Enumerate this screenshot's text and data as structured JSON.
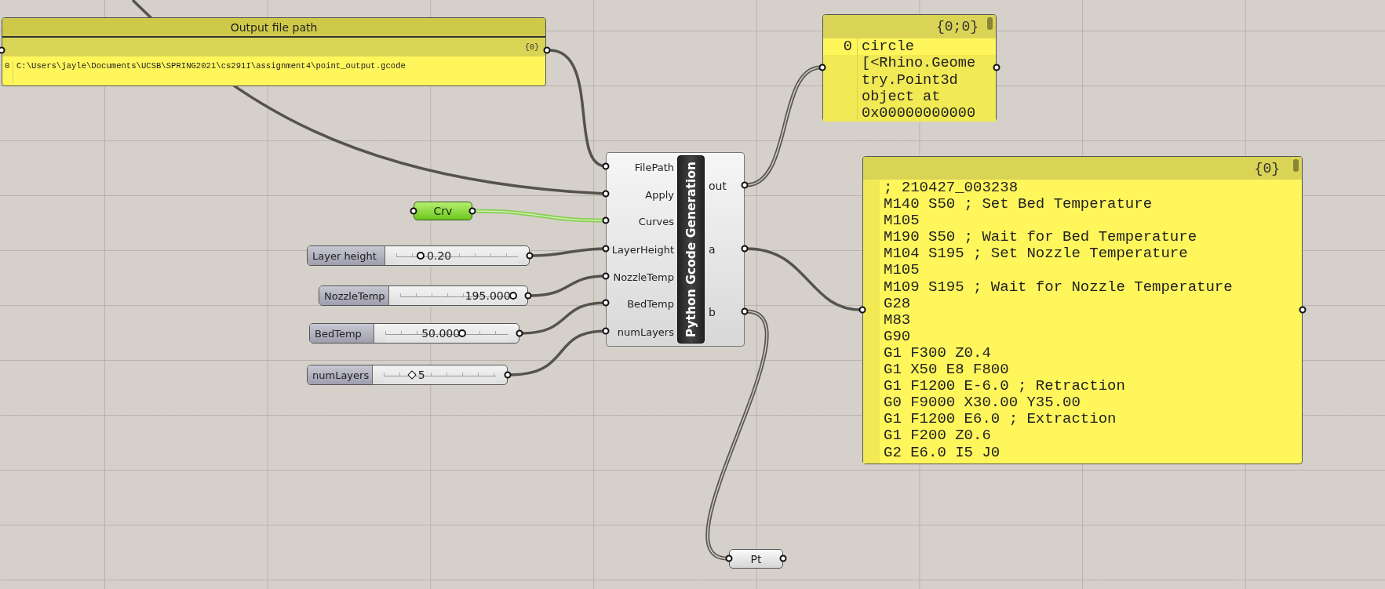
{
  "file_path_panel": {
    "title": "Output file path",
    "path": "{0}",
    "index": "0",
    "value": "C:\\Users\\jayle\\Documents\\UCSB\\SPRING2021\\cs291I\\assignment4\\point_output.gcode"
  },
  "point_panel": {
    "path": "{0;0}",
    "rows": [
      {
        "index": "0",
        "text": "circle",
        "highlighted": true
      },
      {
        "text": "[<Rhino.Geome",
        "highlighted": false
      },
      {
        "text": "try.Point3d",
        "highlighted": false
      },
      {
        "text": "object at",
        "highlighted": false
      },
      {
        "text": "0x00000000000",
        "highlighted": false
      }
    ]
  },
  "curve_param": {
    "label": "Crv"
  },
  "sliders": [
    {
      "label": "Layer height",
      "value": "0.20",
      "level": 0.2,
      "kind": "float"
    },
    {
      "label": "NozzleTemp",
      "value": "195.000",
      "level": 0.97,
      "kind": "float"
    },
    {
      "label": "BedTemp",
      "value": "50.000",
      "level": 0.63,
      "kind": "float"
    },
    {
      "label": "numLayers",
      "value": "5",
      "level": 0.25,
      "kind": "integer"
    }
  ],
  "component": {
    "name": "Python Gcode Generation",
    "inputs": [
      "FilePath",
      "Apply",
      "Curves",
      "LayerHeight",
      "NozzleTemp",
      "BedTemp",
      "numLayers"
    ],
    "outputs": [
      "out",
      "a",
      "b"
    ]
  },
  "gcode_panel": {
    "path": "{0}",
    "lines": [
      "; 210427_003238",
      "M140 S50 ; Set Bed Temperature",
      "M105",
      "M190 S50 ; Wait for Bed Temperature",
      "M104 S195 ; Set Nozzle Temperature",
      "M105",
      "M109 S195 ; Wait for Nozzle Temperature",
      "G28",
      "M83",
      "G90",
      "G1 F300 Z0.4",
      "G1 X50 E8 F800",
      "G1 F1200 E-6.0 ; Retraction",
      "G0 F9000 X30.00 Y35.00",
      "G1 F1200 E6.0 ; Extraction",
      "G1 F200 Z0.6",
      "G2 E6.0 I5 J0"
    ]
  },
  "point_param": {
    "label": "Pt"
  }
}
